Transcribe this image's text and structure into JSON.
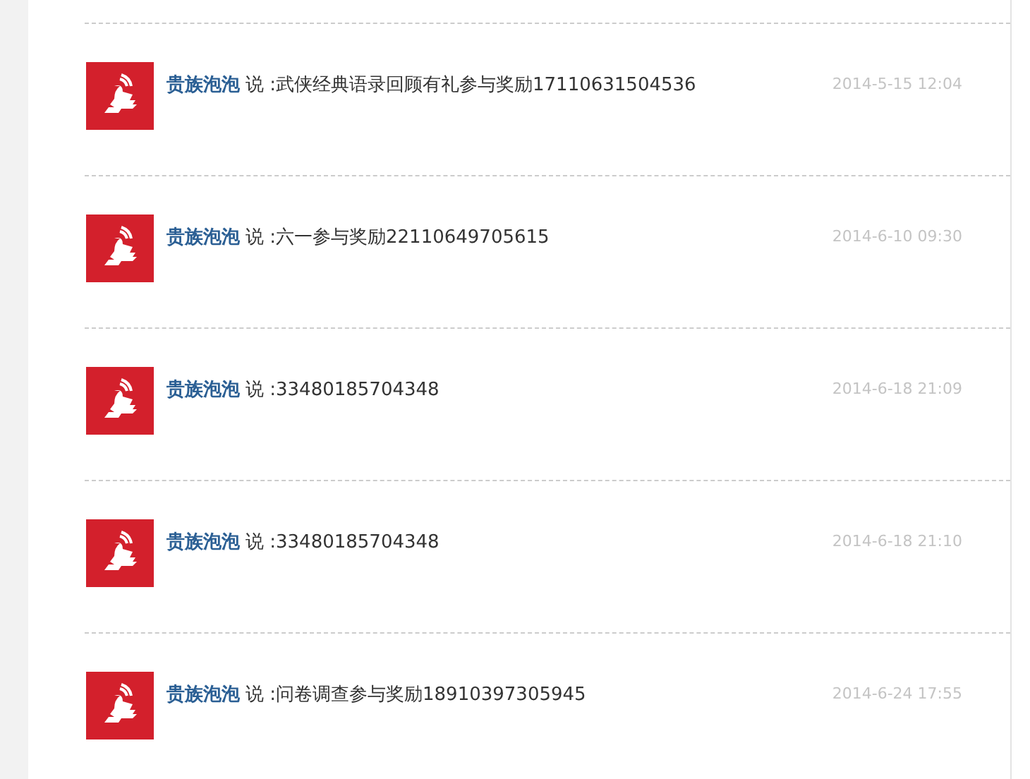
{
  "messages": [
    {
      "author": "贵族泡泡",
      "text": "说 :武侠经典语录回顾有礼参与奖励17110631504536",
      "time": "2014-5-15 12:04"
    },
    {
      "author": "贵族泡泡",
      "text": "说 :六一参与奖励22110649705615",
      "time": "2014-6-10 09:30"
    },
    {
      "author": "贵族泡泡",
      "text": "说 :33480185704348",
      "time": "2014-6-18 21:09"
    },
    {
      "author": "贵族泡泡",
      "text": "说 :33480185704348",
      "time": "2014-6-18 21:10"
    },
    {
      "author": "贵族泡泡",
      "text": "说 :问卷调查参与奖励18910397305945",
      "time": "2014-6-24 17:55"
    }
  ]
}
